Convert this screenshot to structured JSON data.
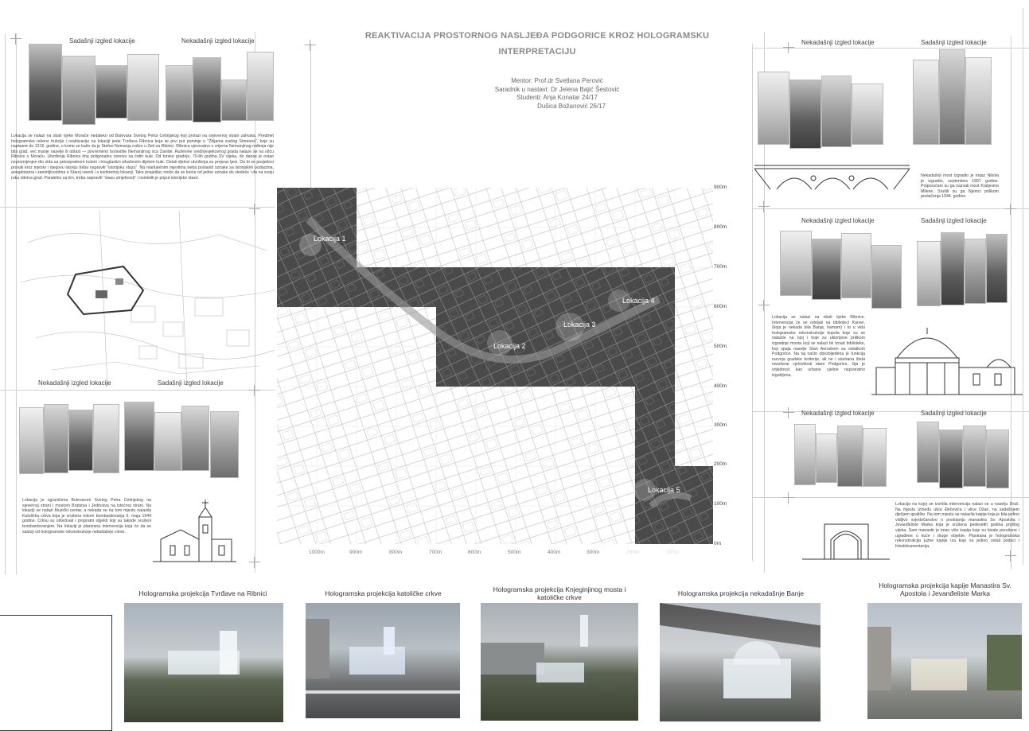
{
  "title": {
    "line1": "REAKTIVACIJA PROSTORNOG NASLJEĐA PODGORICE KROZ HOLOGRAMSKU",
    "line2": "INTERPRETACIJU"
  },
  "credits": {
    "mentor": "Mentor: Prof.dr Svetlana Perović",
    "assistant": "Saradnik u nastavi: Dr Jelena Bajić Šestović",
    "students": "Studenti: Anja Konatar 24/17",
    "student2": "Dušica Božanović 26/17"
  },
  "captions": {
    "current": "Sadašnji izgled lokacije",
    "former": "Nekadašnji izgled lokacije"
  },
  "texts": {
    "fortress": "Lokacija se nalazi na obali rijeke Morače nedaleko od Bulevara Svetog Petra Cetinjskog koji prolazi na svjevernoj strani zahvata. Predmet hologramske rekons trukcije i reaktivacije na lokaciji jeste Tvrđava Ribnica koja se prvi put pominje u \"Žitijama svetog Simeona\", koje su napisane do 1216. godine, u kome se kaže da je Stefan Nemanja rođen u Zeti na Ribnici. Ribnica vjerovatno u vrijeme Nemanjinog rođenja nije bila grad, već manje naselje ili oblast — privremeno boravište Nemanjinog oca Zavide. Ruševine srednjevjekovnog grada nalaze se na ušću Ribnice u Moraču. Utvrđenja Ribnica ima poligonalnu osnovu sa četiri kule. Od turske gradnje, 70-tih godina XV vijeka, do danas je ostao nepromijenjen dio zida sa petospratnom kulom i trouglastim izbačenim dijelom kule. Ostali djelovi utvrđenja su preprav ljeni. Da bi se posjetioci provali kroz mjesto i njegovu istoriju treba napraviti \"istorijsku stazu\". Na markantnim mjestima treba postaviti oznake sa istorijskim podacima, anegdotama i zanimljivostima o Staroj varoši i o konkretnoj lokaciji. Tako posjetilac može da se kreće od jedne oznake do sledeće i da na svoju ruku otkriva grad. Paralelno sa tim, treba napraviti \"stazu umjetnosti\" i osmisliti je poput istorijske staze.",
    "church": "Lokacija je ograničena Bulevarom Svetog Petra Cetinjskog na sjevernoj strani i mostom Bratstva i Jedinstva na istočnoj strani. Na lokaciji se nalazi Muzički centar, a nekada se na tom mjestu nalazila Katolička crkva koja je srušena tokom bombardovanja 5. maja 1944 godine. Crkvu su oštećivali i propratni objekti koji su takođe srušeni bombardovanjem. Na lokaciji je planirana intervencija koja će da se sastoji od hologramske rekonstrukcije nekadašnje crkve.",
    "bridge": "Nekadašnji most izgradio je knjaz Nikola je izgradio, septembra 1907 godine. Potporučani su ga nazvali most Kraljevine Milene. Srušili su ga Njemci prilikom povlačenja 1944. godine.",
    "bath": "Lokacija se nalazi na obali rijeke Ribnice. Intervencija će se odvijati na biblioteci Karver, (koja je nekada bila Banja, hamam) i to u vidu hologramske rekonstrukcije kupola koje su se nalazile na njoj i koje su uklonjene prilikom izgradnje mosta koji se nalazi tik iznad biblioteke, koji spaja naselje Stari Aerodrom sa ostatkom Podgorice. Na taj način obezbijeđena je funkcija razvoja gradske teritorije, ali ne i sanirana šteta narušene cjelovitosti stare Podgorice, čija je vrijednost kao urbane cjeline nepovratno izgubljena.",
    "monastery": "Lokacija na kojoj se izvršila intervencija nalazi se u naselju Drač. Na mjestu između ulice Đečevića i ulice Džan, na sadašnjem dječjem igralištu. Na tom mjestu se nalazila kapija koja je bila jedino vidljivo svjedočanstvo o postojanju manastira Sv. Apostola i Jevanđeliste Marka koja je srušena pedesetih godina prošlog vijeka. Sam manastir je imao više kapija koje su bivale porušene i ugrađene u kuće i druge objekte. Planirana je hologramska rekonstrukcija južne kapije iza koje su jedino ostali podaci i fotodokumentacija."
  },
  "map": {
    "locations": [
      "Lokacija 1",
      "Lokacija 2",
      "Lokacija 3",
      "Lokacija 4",
      "Lokacija 5"
    ],
    "y_ticks": [
      "900m",
      "800m",
      "700m",
      "600m",
      "500m",
      "400m",
      "300m",
      "200m",
      "100m",
      "0m"
    ],
    "x_ticks": [
      "1000m",
      "900m",
      "800m",
      "700m",
      "600m",
      "500m",
      "400m",
      "300m",
      "200m",
      "100m"
    ]
  },
  "bottom": [
    {
      "caption": "Hologramska projekcija Tvrđave na Ribnici"
    },
    {
      "caption": "Hologramska projekcija katoličke crkve"
    },
    {
      "caption": "Hologramska projekcija Knjeginjinog mosta i katoličke crkve"
    },
    {
      "caption": "Hologramska projekcija nekadašnje Banje"
    },
    {
      "caption": "Hologramska projekcija kapije Manastira Sv. Apostola i Jevanđeliste Marka"
    }
  ]
}
